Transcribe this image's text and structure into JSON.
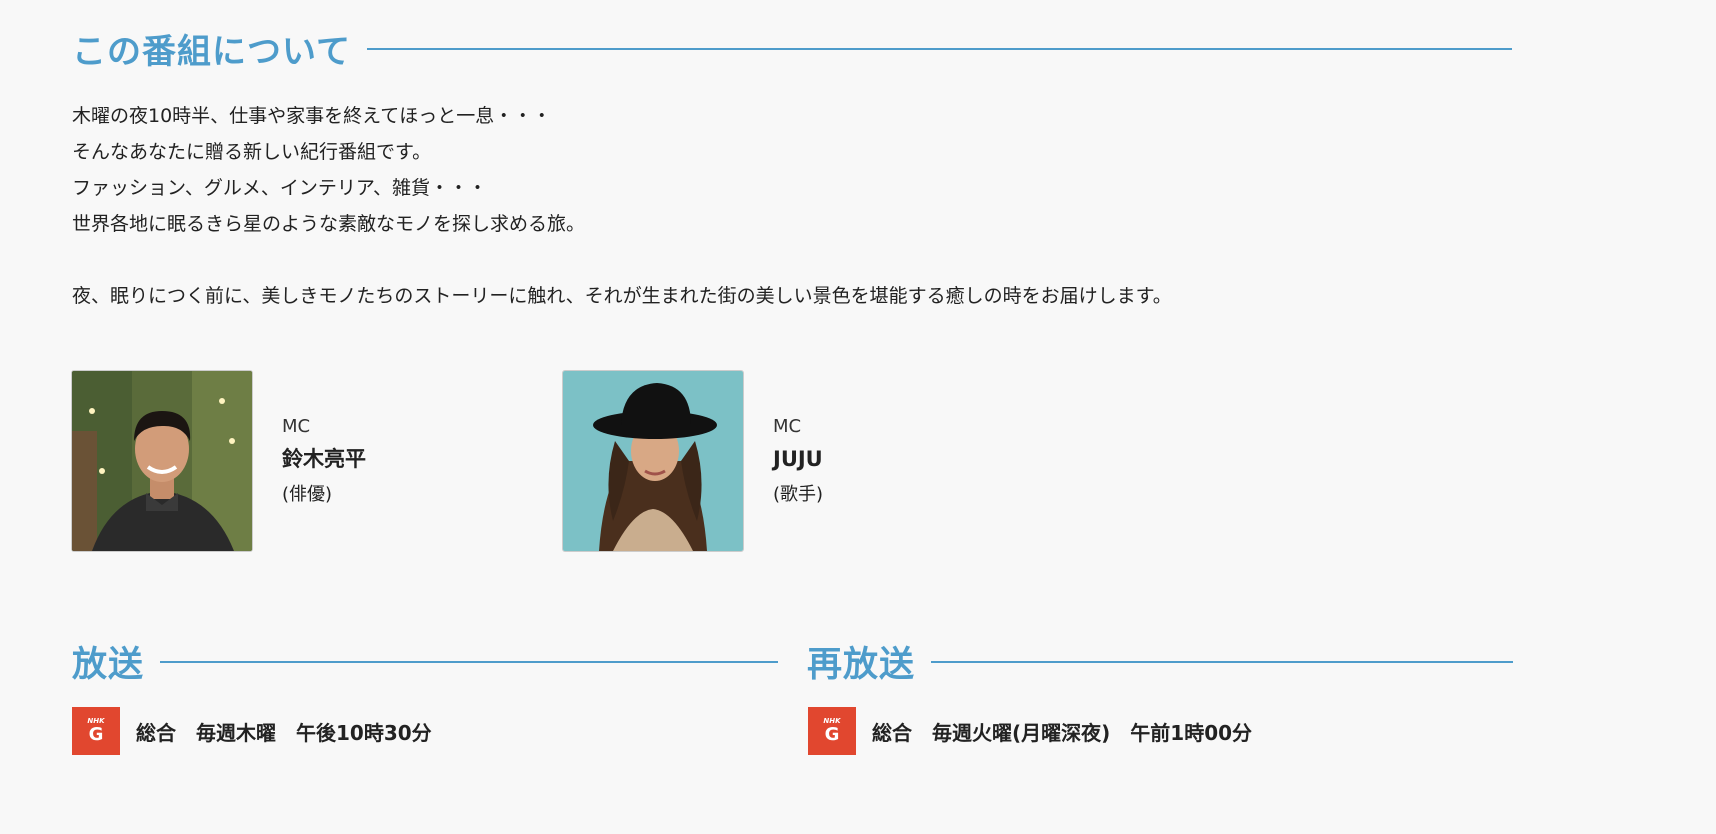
{
  "about": {
    "title": "この番組について",
    "lines": [
      "木曜の夜10時半、仕事や家事を終えてほっと一息・・・",
      "そんなあなたに贈る新しい紀行番組です。",
      "ファッション、グルメ、インテリア、雑貨・・・",
      "世界各地に眠るきら星のような素敵なモノを探し求める旅。",
      "夜、眠りにつく前に、美しきモノたちのストーリーに触れ、それが生まれた街の美しい景色を堪能する癒しの時をお届けします。"
    ]
  },
  "cast": [
    {
      "role": "MC",
      "name": "鈴木亮平",
      "job": "(俳優)"
    },
    {
      "role": "MC",
      "name": "JUJU",
      "job": "(歌手)"
    }
  ],
  "broadcast": {
    "title": "放送",
    "logo_top": "NHK",
    "logo_letter": "G",
    "schedule": "総合　毎週木曜　午後10時30分"
  },
  "rebroadcast": {
    "title": "再放送",
    "logo_top": "NHK",
    "logo_letter": "G",
    "schedule": "総合　毎週火曜(月曜深夜)　午前1時00分"
  },
  "colors": {
    "accent": "#4e9ccb",
    "nhk_g_logo": "#e1472f",
    "background": "#f8f8f8"
  }
}
